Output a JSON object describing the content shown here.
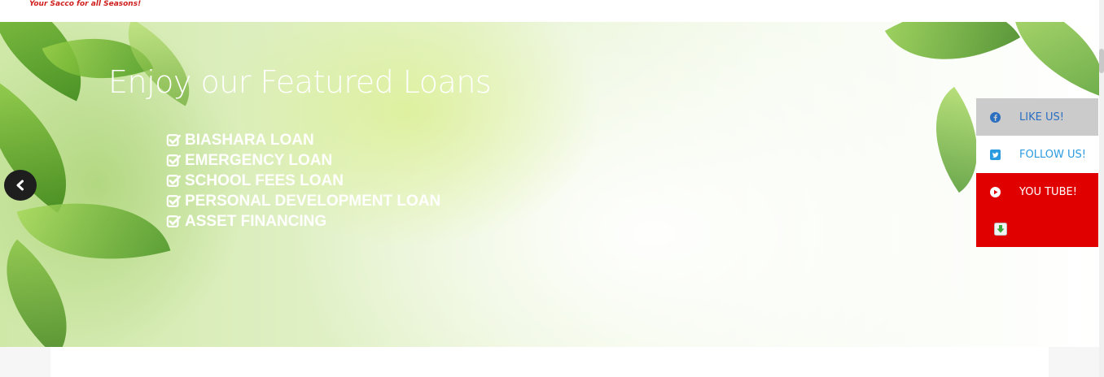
{
  "header": {
    "tagline": "Your Sacco for all Seasons!"
  },
  "hero": {
    "title": "Enjoy our Featured Loans",
    "loans": [
      " BIASHARA LOAN",
      "EMERGENCY LOAN",
      " SCHOOL FEES LOAN",
      "PERSONAL DEVELOPMENT LOAN",
      "ASSET FINANCING"
    ],
    "prev_icon": "chevron-left-icon"
  },
  "social": {
    "facebook_label": "LIKE US!",
    "twitter_label": "FOLLOW US!",
    "youtube_label": "YOU TUBE!",
    "download_icon": "download-icon"
  },
  "colors": {
    "brand_red": "#e00000",
    "tagline_red": "#d01d1d",
    "facebook_blue": "#2b6fc0",
    "twitter_blue": "#2b9be0"
  }
}
